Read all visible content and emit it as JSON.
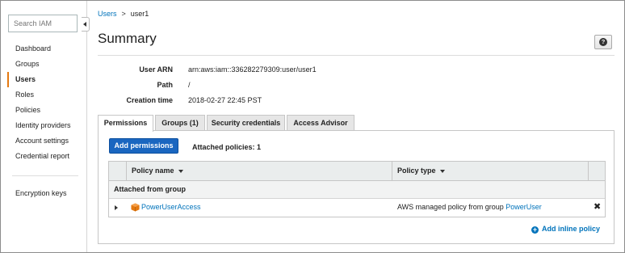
{
  "sidebar": {
    "search_placeholder": "Search IAM",
    "items": [
      {
        "label": "Dashboard"
      },
      {
        "label": "Groups"
      },
      {
        "label": "Users"
      },
      {
        "label": "Roles"
      },
      {
        "label": "Policies"
      },
      {
        "label": "Identity providers"
      },
      {
        "label": "Account settings"
      },
      {
        "label": "Credential report"
      }
    ],
    "active_item": "Users",
    "extra_items": [
      {
        "label": "Encryption keys"
      }
    ]
  },
  "breadcrumb": {
    "parent": "Users",
    "separator": ">",
    "current": "user1"
  },
  "page": {
    "title": "Summary",
    "help_label": "?"
  },
  "summary": {
    "user_arn_label": "User ARN",
    "user_arn_value": "arn:aws:iam::336282279309:user/user1",
    "path_label": "Path",
    "path_value": "/",
    "creation_time_label": "Creation time",
    "creation_time_value": "2018-02-27 22:45 PST"
  },
  "tabs": [
    {
      "label": "Permissions",
      "active": true
    },
    {
      "label": "Groups (1)"
    },
    {
      "label": "Security credentials"
    },
    {
      "label": "Access Advisor"
    }
  ],
  "permissions": {
    "add_button_label": "Add permissions",
    "attached_count_label": "Attached policies: 1",
    "table": {
      "columns": [
        "Policy name",
        "Policy type"
      ],
      "group_header": "Attached from group",
      "rows": [
        {
          "policy_name": "PowerUserAccess",
          "policy_type_prefix": "AWS managed policy from group ",
          "policy_type_link": "PowerUser",
          "remove_label": "✖"
        }
      ]
    },
    "add_inline_label": "Add inline policy",
    "add_inline_icon": "+"
  },
  "colors": {
    "accent_orange": "#e47911",
    "link_blue": "#0073bb",
    "primary_button": "#1a66c0"
  }
}
